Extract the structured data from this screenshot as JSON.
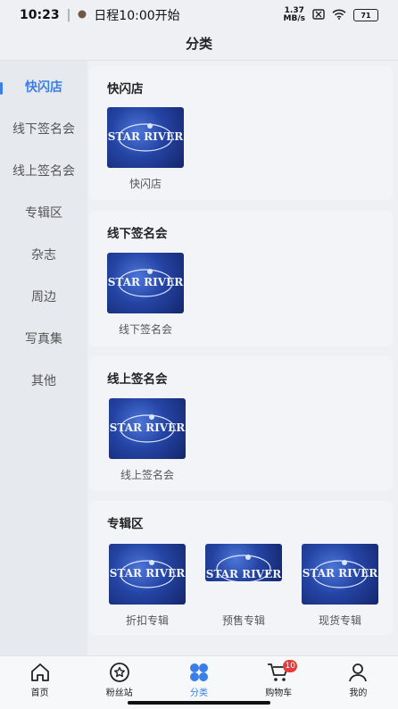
{
  "status_bar": {
    "time": "10:23",
    "notification": "日程10:00开始",
    "net_speed_value": "1.37",
    "net_speed_unit": "MB/s",
    "battery": "71"
  },
  "header": {
    "title": "分类"
  },
  "sidebar": {
    "items": [
      {
        "label": "快闪店",
        "active": true
      },
      {
        "label": "线下签名会"
      },
      {
        "label": "线上签名会"
      },
      {
        "label": "专辑区"
      },
      {
        "label": "杂志"
      },
      {
        "label": "周边"
      },
      {
        "label": "写真集"
      },
      {
        "label": "其他"
      }
    ]
  },
  "sections": [
    {
      "title": "快闪店",
      "items": [
        {
          "label": "快闪店",
          "logo": "STAR RIVER"
        }
      ]
    },
    {
      "title": "线下签名会",
      "items": [
        {
          "label": "线下签名会",
          "logo": "STAR RIVER"
        }
      ]
    },
    {
      "title": "线上签名会",
      "items": [
        {
          "label": "线上签名会",
          "logo": "STAR RIVER"
        }
      ]
    },
    {
      "title": "专辑区",
      "items": [
        {
          "label": "折扣专辑",
          "logo": "STAR RIVER"
        },
        {
          "label": "预售专辑",
          "logo": "STAR RIVER"
        },
        {
          "label": "现货专辑",
          "logo": "STAR RIVER"
        }
      ]
    }
  ],
  "tabbar": {
    "tabs": [
      {
        "label": "首页",
        "icon": "home-icon"
      },
      {
        "label": "粉丝站",
        "icon": "star-circle-icon"
      },
      {
        "label": "分类",
        "icon": "category-icon",
        "active": true
      },
      {
        "label": "购物车",
        "icon": "cart-icon",
        "badge": "10"
      },
      {
        "label": "我的",
        "icon": "profile-icon"
      }
    ]
  },
  "colors": {
    "accent": "#3a7ee8",
    "badge": "#e63b3b"
  }
}
